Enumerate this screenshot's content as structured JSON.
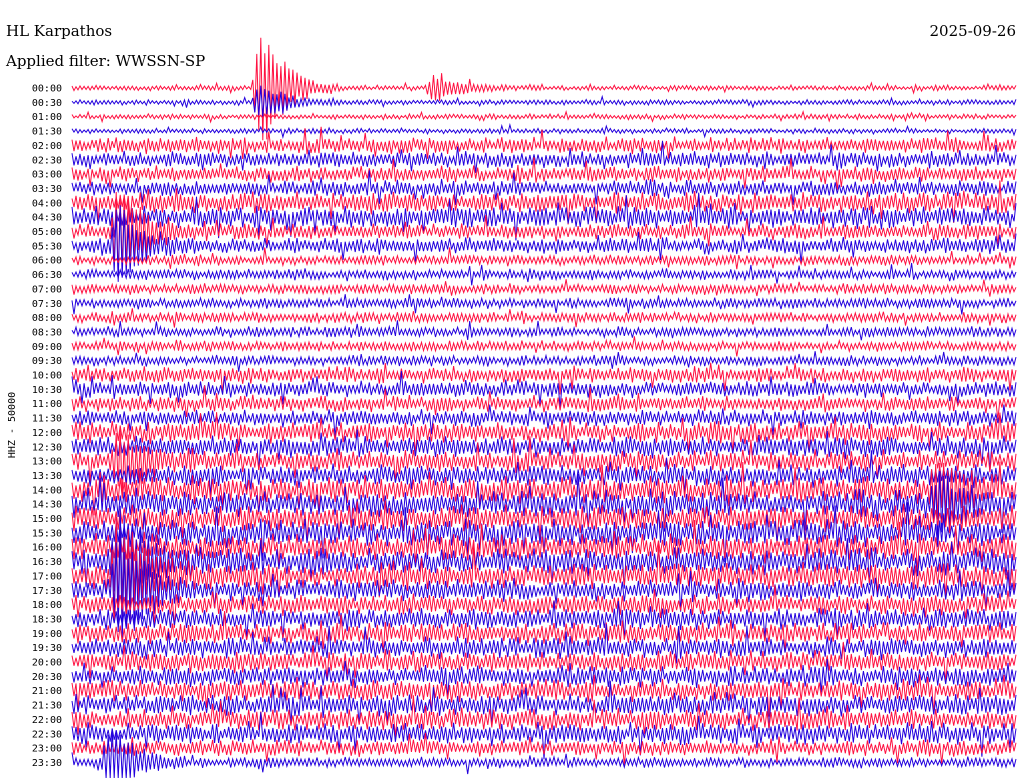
{
  "header": {
    "station": "HL Karpathos",
    "date": "2025-09-26",
    "filter": "Applied filter: WWSSN-SP"
  },
  "chart_data": {
    "type": "line",
    "chart_kind": "helicorder",
    "channel_label": "HHZ - 50000",
    "row_labels": [
      "00:00",
      "00:30",
      "01:00",
      "01:30",
      "02:00",
      "02:30",
      "03:00",
      "03:30",
      "04:00",
      "04:30",
      "05:00",
      "05:30",
      "06:00",
      "06:30",
      "07:00",
      "07:30",
      "08:00",
      "08:30",
      "09:00",
      "09:30",
      "10:00",
      "10:30",
      "11:00",
      "11:30",
      "12:00",
      "12:30",
      "13:00",
      "13:30",
      "14:00",
      "14:30",
      "15:00",
      "15:30",
      "16:00",
      "16:30",
      "17:00",
      "17:30",
      "18:00",
      "18:30",
      "19:00",
      "19:30",
      "20:00",
      "20:30",
      "21:00",
      "21:30",
      "22:00",
      "22:30",
      "23:00",
      "23:30"
    ],
    "minutes_per_row": 30,
    "colors": [
      "#2200dd",
      "#ff1040"
    ],
    "line_color_order": "alternating starting with red on 00:00, blue on 00:30",
    "noise_level": [
      1,
      1,
      1,
      1,
      3,
      3,
      3,
      3,
      4,
      4,
      3,
      3,
      2,
      2,
      2,
      2,
      2,
      2,
      2,
      2,
      3,
      3,
      3,
      3,
      4,
      4,
      4,
      4,
      5,
      5,
      5,
      5,
      5,
      5,
      5,
      4,
      4,
      4,
      4,
      4,
      4,
      4,
      4,
      4,
      4,
      4,
      3,
      2
    ],
    "events": [
      {
        "row": 0,
        "minute": 6,
        "amplitude": 10,
        "label": "large spike"
      },
      {
        "row": 1,
        "minute": 6,
        "amplitude": 3
      },
      {
        "row": 0,
        "minute": 11.5,
        "amplitude": 2
      },
      {
        "row": 10,
        "minute": 1.5,
        "amplitude": 8
      },
      {
        "row": 11,
        "minute": 1.5,
        "amplitude": 6
      },
      {
        "row": 26,
        "minute": 1.5,
        "amplitude": 5
      },
      {
        "row": 33,
        "minute": 1.5,
        "amplitude": 9
      },
      {
        "row": 34,
        "minute": 1.5,
        "amplitude": 10
      },
      {
        "row": 35,
        "minute": 1.5,
        "amplitude": 9
      },
      {
        "row": 47,
        "minute": 1.2,
        "amplitude": 6
      },
      {
        "row": 28,
        "minute": 27.5,
        "amplitude": 4
      },
      {
        "row": 29,
        "minute": 27.5,
        "amplitude": 4
      }
    ]
  }
}
